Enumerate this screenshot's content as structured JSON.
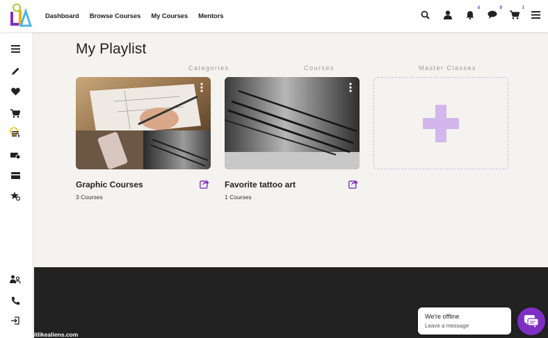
{
  "brand": {
    "accent": "#7f2fc4",
    "badge_color": "#7b2fbf"
  },
  "nav": {
    "links": [
      {
        "label": "Dashboard"
      },
      {
        "label": "Browse Courses"
      },
      {
        "label": "My Courses"
      },
      {
        "label": "Mentors"
      }
    ]
  },
  "topbar_icons": [
    {
      "icon": "search-icon"
    },
    {
      "icon": "user-icon"
    },
    {
      "icon": "bell-icon",
      "badge": "4"
    },
    {
      "icon": "messages-icon",
      "badge": "0"
    },
    {
      "icon": "cart-icon",
      "badge": "1"
    },
    {
      "icon": "menu-icon"
    }
  ],
  "sidebar_icons": [
    "menu-icon",
    "pencil-icon",
    "heart-icon",
    "cart-icon",
    "playlist-icon",
    "ticket-icon",
    "card-icon",
    "star-icon",
    "users-icon",
    "phone-icon",
    "logout-icon"
  ],
  "page": {
    "title": "My Playlist"
  },
  "playlists": [
    {
      "title": "Graphic Courses",
      "count": "3 Courses"
    },
    {
      "title": "Favorite tattoo art",
      "count": "1 Courses"
    }
  ],
  "footer": {
    "site": "itlikealiens.com",
    "columns": [
      "Categories",
      "Courses",
      "Master Classes"
    ]
  },
  "chat": {
    "title": "We're offline",
    "subtitle": "Leave a message"
  }
}
